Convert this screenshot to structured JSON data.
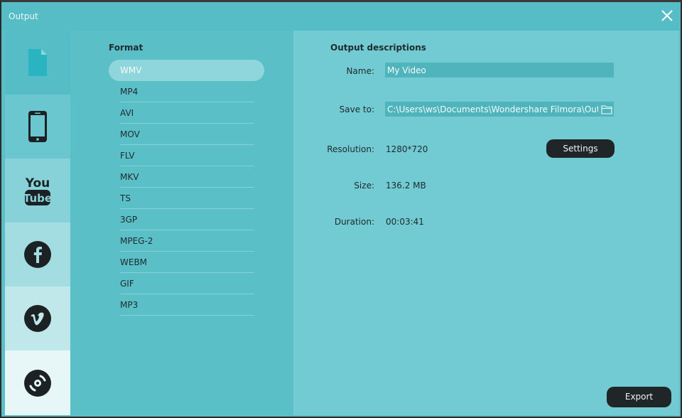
{
  "window": {
    "title": "Output"
  },
  "rail": {
    "items": [
      {
        "id": "local",
        "icon": "document-icon",
        "bg": "#56bcc5",
        "active": true
      },
      {
        "id": "device",
        "icon": "smartphone-icon",
        "bg": "#6ac7cf"
      },
      {
        "id": "youtube",
        "icon": "youtube-icon",
        "bg": "#86d2d8"
      },
      {
        "id": "facebook",
        "icon": "facebook-icon",
        "bg": "#a4dde1"
      },
      {
        "id": "vimeo",
        "icon": "vimeo-icon",
        "bg": "#c0e8ea"
      },
      {
        "id": "dvd",
        "icon": "disc-icon",
        "bg": "#e7f6f7"
      }
    ]
  },
  "format": {
    "title": "Format",
    "selected": "WMV",
    "items": [
      "WMV",
      "MP4",
      "AVI",
      "MOV",
      "FLV",
      "MKV",
      "TS",
      "3GP",
      "MPEG-2",
      "WEBM",
      "GIF",
      "MP3"
    ]
  },
  "output": {
    "title": "Output descriptions",
    "name_label": "Name:",
    "name_value": "My Video",
    "save_label": "Save to:",
    "save_value": "C:\\Users\\ws\\Documents\\Wondershare Filmora\\Output",
    "resolution_label": "Resolution:",
    "resolution_value": "1280*720",
    "settings_label": "Settings",
    "size_label": "Size:",
    "size_value": "136.2 MB",
    "duration_label": "Duration:",
    "duration_value": "00:03:41",
    "export_label": "Export"
  },
  "colors": {
    "panel": "#5bbfc8",
    "desc_panel": "#72cbd2",
    "field": "#50b4bd",
    "button": "#202527",
    "icon_dark": "#1c2224",
    "icon_accent": "#2ab3c0"
  }
}
